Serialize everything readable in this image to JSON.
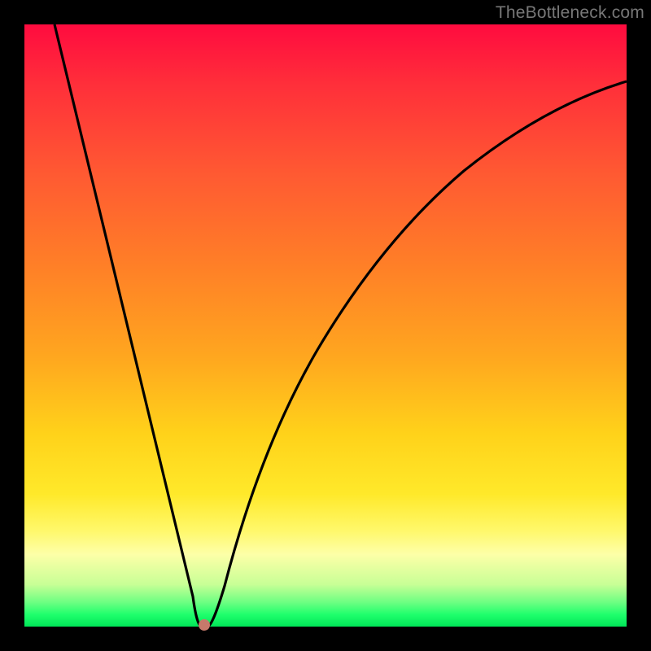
{
  "watermark": {
    "text": "TheBottleneck.com"
  },
  "colors": {
    "gradient_stops": [
      "#ff0b3f",
      "#ff2f3a",
      "#ff5a32",
      "#ff7f27",
      "#ffa61f",
      "#ffd21a",
      "#ffe92a",
      "#fff86a",
      "#fdffa8",
      "#c8ff96",
      "#6cff82",
      "#1fff6c",
      "#00e658"
    ],
    "curve": "#000000",
    "marker": "#c7796b",
    "background": "#000000"
  },
  "chart_data": {
    "type": "line",
    "title": "",
    "xlabel": "",
    "ylabel": "",
    "xlim": [
      0,
      100
    ],
    "ylim": [
      0,
      100
    ],
    "grid": false,
    "legend": false,
    "annotations": [],
    "marker": {
      "x": 29,
      "y": 0
    },
    "series": [
      {
        "name": "curve",
        "x": [
          5,
          8,
          11,
          14,
          17,
          20,
          23,
          25,
          27,
          28,
          29,
          30,
          32,
          34,
          37,
          40,
          44,
          48,
          52,
          56,
          60,
          65,
          70,
          75,
          80,
          85,
          90,
          95,
          100
        ],
        "y": [
          100,
          88,
          76,
          64,
          52,
          40,
          28,
          19,
          10,
          5,
          0,
          5,
          15,
          25,
          38,
          48,
          58,
          65,
          71,
          75,
          78,
          81,
          83.5,
          85.5,
          87,
          88.2,
          89.2,
          90,
          90.6
        ]
      }
    ]
  }
}
